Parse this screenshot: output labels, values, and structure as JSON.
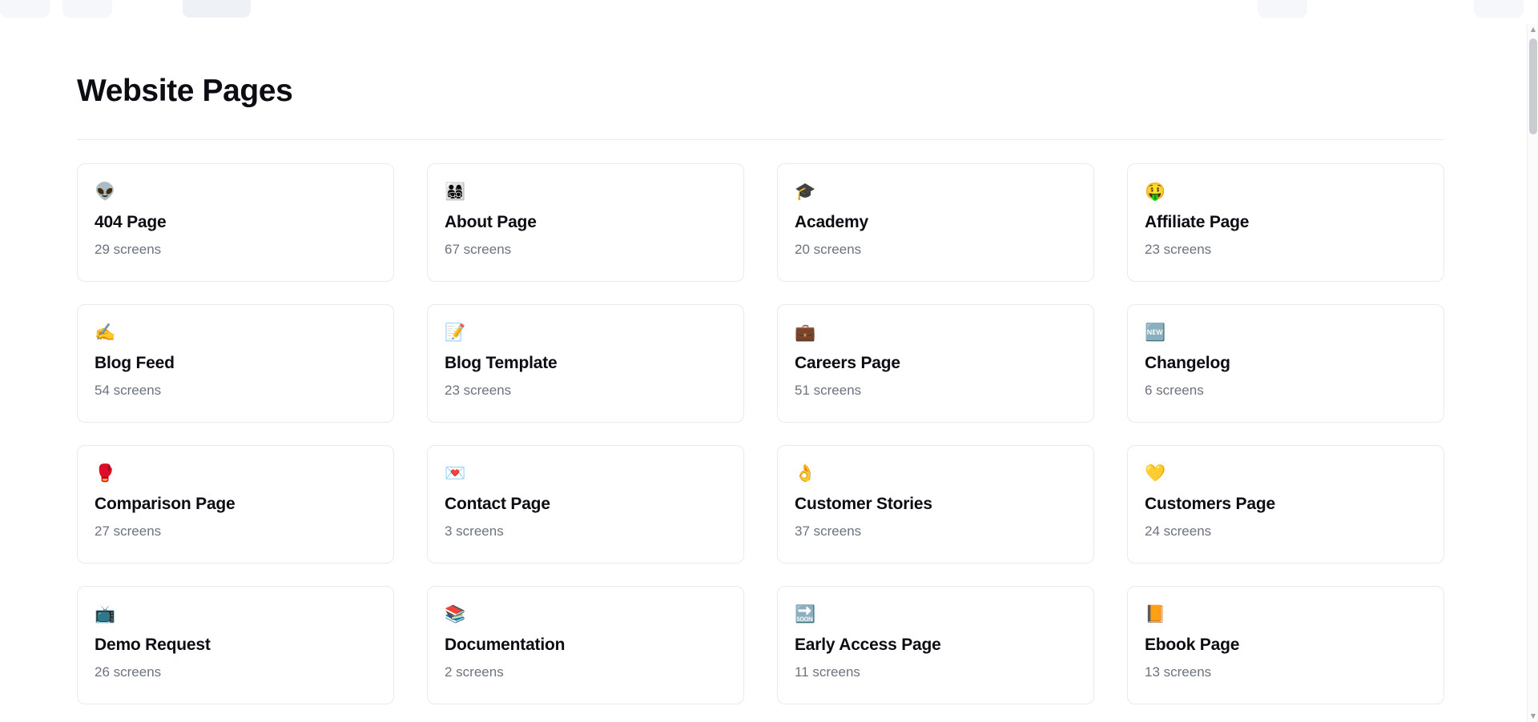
{
  "page": {
    "title": "Website Pages",
    "count_suffix": "screens"
  },
  "scrollbar": {
    "arrow_up": "▲",
    "arrow_down": "▼"
  },
  "cards": [
    {
      "icon": "👽",
      "icon_name": "alien-icon",
      "title": "404 Page",
      "count": "29 screens"
    },
    {
      "icon": "👨‍👩‍👧‍👦",
      "icon_name": "family-icon",
      "title": "About Page",
      "count": "67 screens"
    },
    {
      "icon": "🎓",
      "icon_name": "graduation-cap-icon",
      "title": "Academy",
      "count": "20 screens"
    },
    {
      "icon": "🤑",
      "icon_name": "money-mouth-face-icon",
      "title": "Affiliate Page",
      "count": "23 screens"
    },
    {
      "icon": "✍️",
      "icon_name": "writing-hand-icon",
      "title": "Blog Feed",
      "count": "54 screens"
    },
    {
      "icon": "📝",
      "icon_name": "memo-icon",
      "title": "Blog Template",
      "count": "23 screens"
    },
    {
      "icon": "💼",
      "icon_name": "briefcase-icon",
      "title": "Careers Page",
      "count": "51 screens"
    },
    {
      "icon": "🆕",
      "icon_name": "new-badge-icon",
      "title": "Changelog",
      "count": "6 screens"
    },
    {
      "icon": "🥊",
      "icon_name": "boxing-glove-icon",
      "title": "Comparison Page",
      "count": "27 screens"
    },
    {
      "icon": "💌",
      "icon_name": "love-letter-icon",
      "title": "Contact Page",
      "count": "3 screens"
    },
    {
      "icon": "👌",
      "icon_name": "ok-hand-icon",
      "title": "Customer Stories",
      "count": "37 screens"
    },
    {
      "icon": "💛",
      "icon_name": "yellow-heart-icon",
      "title": "Customers Page",
      "count": "24 screens"
    },
    {
      "icon": "📺",
      "icon_name": "television-icon",
      "title": "Demo Request",
      "count": "26 screens"
    },
    {
      "icon": "📚",
      "icon_name": "books-icon",
      "title": "Documentation",
      "count": "2 screens"
    },
    {
      "icon": "🔜",
      "icon_name": "soon-badge-icon",
      "title": "Early Access Page",
      "count": "11 screens"
    },
    {
      "icon": "📙",
      "icon_name": "orange-book-icon",
      "title": "Ebook Page",
      "count": "13 screens"
    }
  ]
}
